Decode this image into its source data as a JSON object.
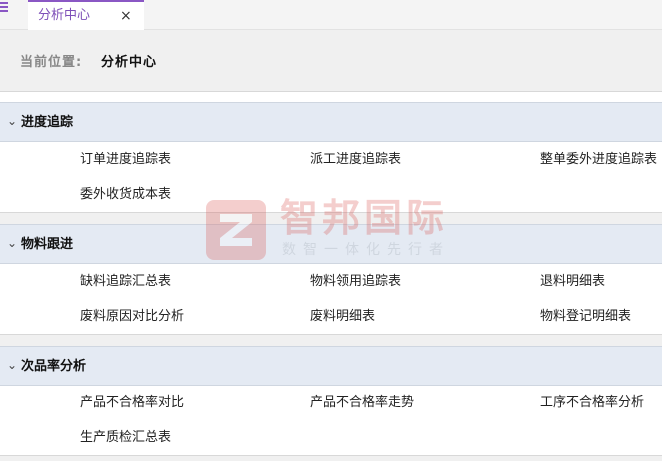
{
  "tab": {
    "label": "分析中心",
    "close_icon": "×"
  },
  "breadcrumb": {
    "label": "当前位置:",
    "value": "分析中心"
  },
  "sections": [
    {
      "title": "进度追踪",
      "items": [
        "订单进度追踪表",
        "派工进度追踪表",
        "整单委外进度追踪表",
        "委外收货成本表"
      ]
    },
    {
      "title": "物料跟进",
      "items": [
        "缺料追踪汇总表",
        "物料领用追踪表",
        "退料明细表",
        "废料原因对比分析",
        "废料明细表",
        "物料登记明细表"
      ]
    },
    {
      "title": "次品率分析",
      "items": [
        "产品不合格率对比",
        "产品不合格率走势",
        "工序不合格率分析",
        "生产质检汇总表"
      ]
    }
  ],
  "watermark": {
    "title": "智邦国际",
    "subtitle": "数智一体化先行者"
  },
  "colors": {
    "accent": "#7e4fb8",
    "section_header_bg": "#e4eaf3",
    "watermark": "#d9534f"
  }
}
